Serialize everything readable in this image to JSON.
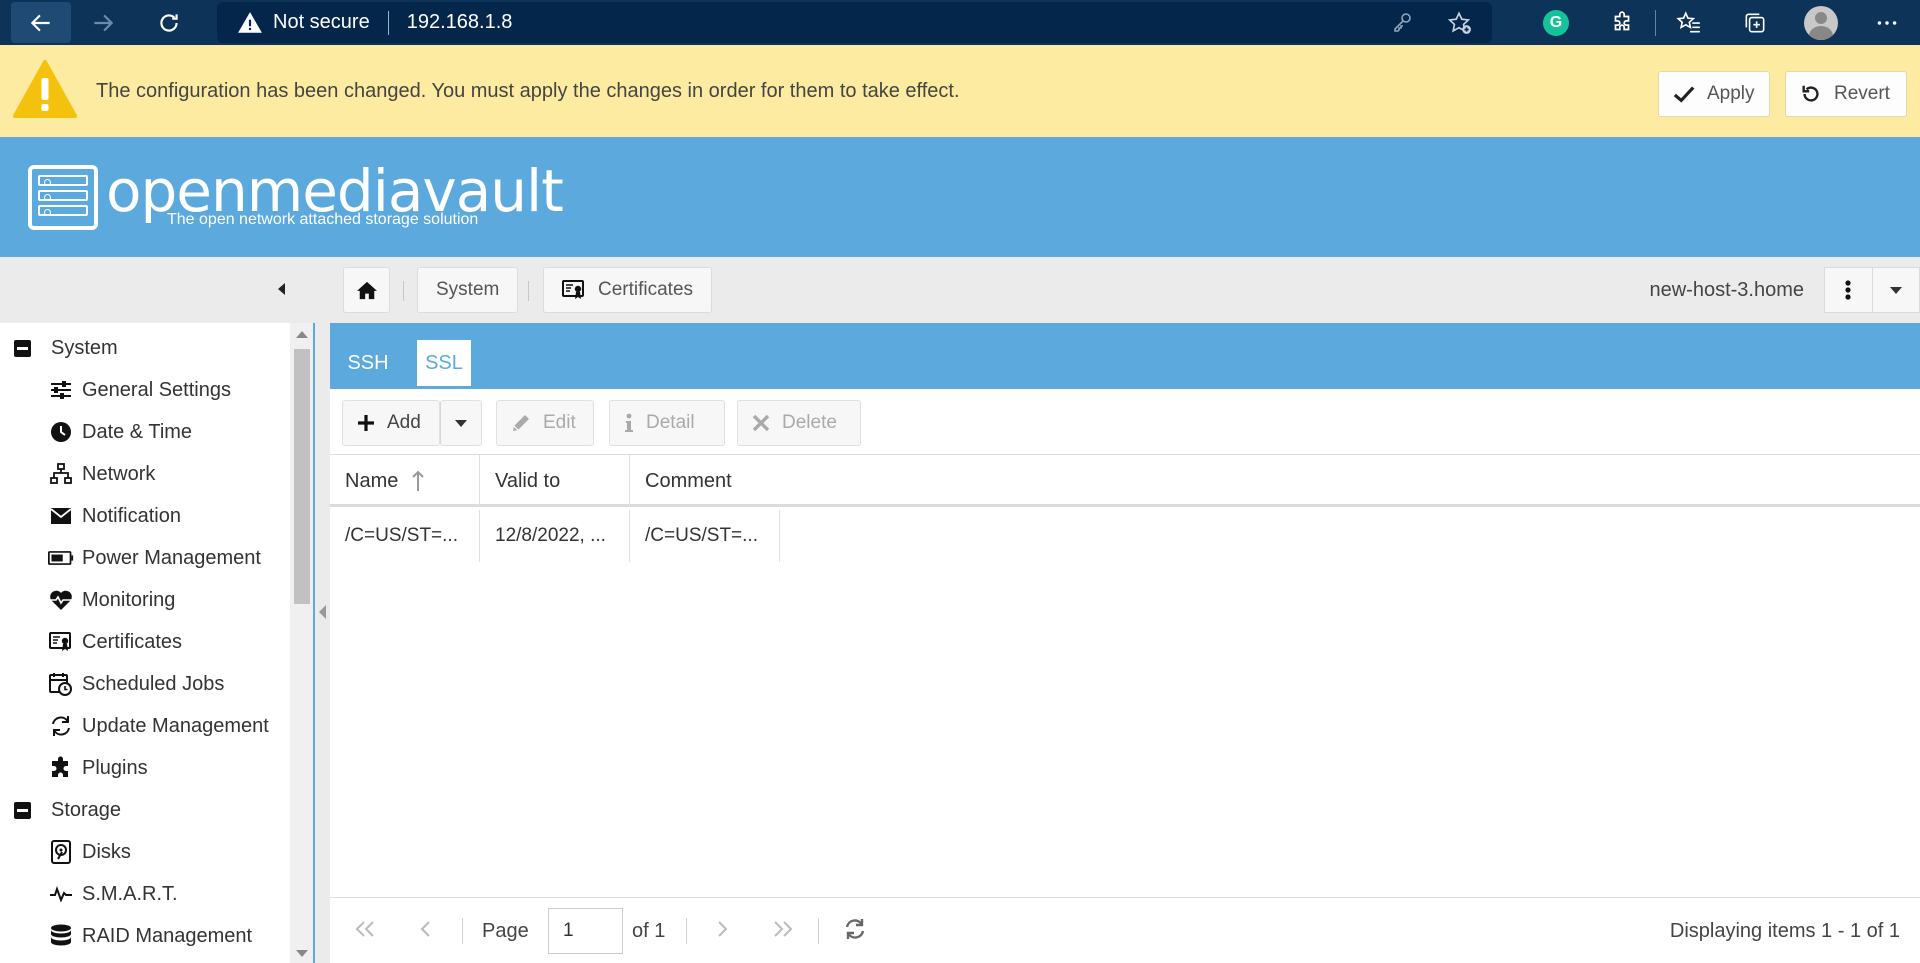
{
  "browser": {
    "security_label": "Not secure",
    "url": "192.168.1.8"
  },
  "banner": {
    "message": "The configuration has been changed. You must apply the changes in order for them to take effect.",
    "apply_label": "Apply",
    "revert_label": "Revert"
  },
  "header": {
    "logo_title": "openmediavault",
    "logo_subtitle": "The open network attached storage solution",
    "brand_color": "#5ba9dd"
  },
  "breadcrumb": {
    "items": [
      "System",
      "Certificates"
    ],
    "hostname": "new-host-3.home"
  },
  "sidebar": {
    "groups": [
      {
        "label": "System",
        "items": [
          {
            "label": "General Settings",
            "icon": "sliders-icon"
          },
          {
            "label": "Date & Time",
            "icon": "clock-icon"
          },
          {
            "label": "Network",
            "icon": "network-icon"
          },
          {
            "label": "Notification",
            "icon": "envelope-icon"
          },
          {
            "label": "Power Management",
            "icon": "battery-icon"
          },
          {
            "label": "Monitoring",
            "icon": "heartbeat-icon"
          },
          {
            "label": "Certificates",
            "icon": "certificate-icon"
          },
          {
            "label": "Scheduled Jobs",
            "icon": "calendar-clock-icon"
          },
          {
            "label": "Update Management",
            "icon": "refresh-icon"
          },
          {
            "label": "Plugins",
            "icon": "puzzle-icon"
          }
        ]
      },
      {
        "label": "Storage",
        "items": [
          {
            "label": "Disks",
            "icon": "disk-icon"
          },
          {
            "label": "S.M.A.R.T.",
            "icon": "pulse-icon"
          },
          {
            "label": "RAID Management",
            "icon": "database-icon"
          }
        ]
      }
    ]
  },
  "tabs": [
    {
      "label": "SSH",
      "active": false
    },
    {
      "label": "SSL",
      "active": true
    }
  ],
  "toolbar": {
    "add_label": "Add",
    "edit_label": "Edit",
    "detail_label": "Detail",
    "delete_label": "Delete"
  },
  "grid": {
    "columns": [
      "Name",
      "Valid to",
      "Comment"
    ],
    "rows": [
      [
        "/C=US/ST=...",
        "12/8/2022, ...",
        "/C=US/ST=..."
      ]
    ]
  },
  "pager": {
    "page_label": "Page",
    "page_value": "1",
    "of_label": "of 1",
    "status": "Displaying items 1 - 1 of 1"
  }
}
